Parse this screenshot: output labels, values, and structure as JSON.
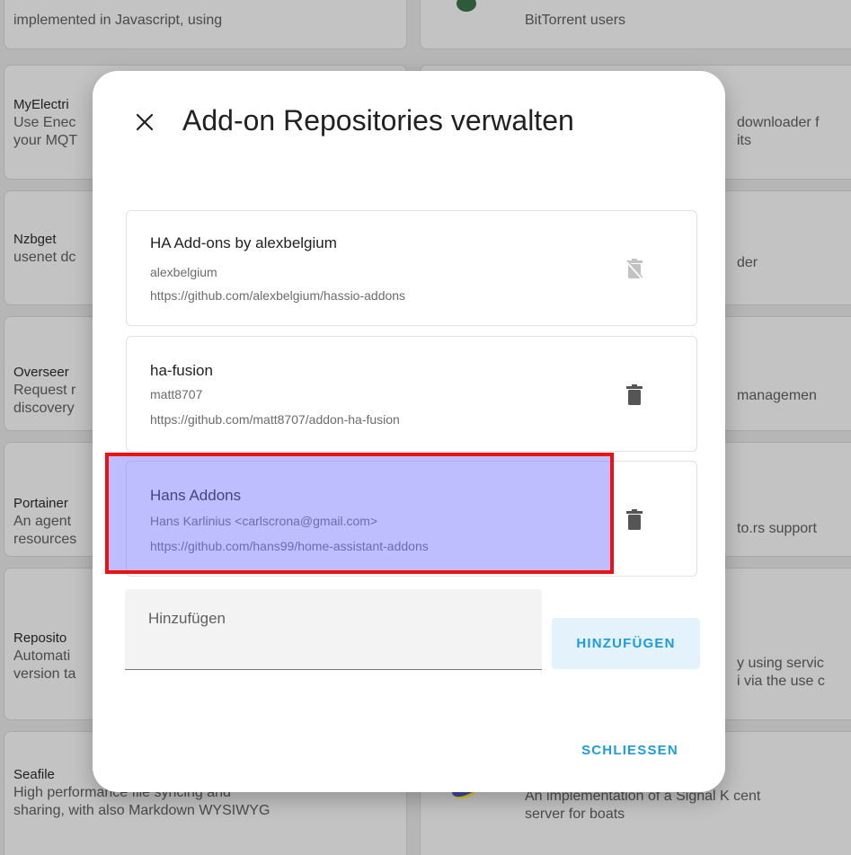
{
  "background": {
    "left_cards": [
      {
        "title": "",
        "desc1": "implemented in Javascript, using",
        "desc2": ""
      },
      {
        "title": "MyElectri",
        "desc1": "Use Enec",
        "desc2": "your MQT"
      },
      {
        "title": "Nzbget",
        "desc1": "usenet dc",
        "desc2": ""
      },
      {
        "title": "Overseer",
        "desc1": "Request r",
        "desc2": "discovery"
      },
      {
        "title": "Portainer",
        "desc1": "An agent",
        "desc2": "resources"
      },
      {
        "title": "Reposito",
        "desc1": "Automati",
        "desc2": "version ta"
      },
      {
        "title": "Seafile",
        "desc1": "High performance file syncing and",
        "desc2": "sharing, with also Markdown WYSIWYG"
      }
    ],
    "right_cards": [
      {
        "desc1": "BitTorrent users",
        "desc2": ""
      },
      {
        "desc1": "downloader f",
        "desc2": "its"
      },
      {
        "desc1": "der",
        "desc2": ""
      },
      {
        "desc1": "managemen",
        "desc2": ""
      },
      {
        "desc1": "to.rs support",
        "desc2": ""
      },
      {
        "desc1": "y using servic",
        "desc2": "i via the use c"
      },
      {
        "desc1": "An implementation of a Signal K cent",
        "desc2": "server for boats"
      }
    ]
  },
  "dialog": {
    "title": "Add-on Repositories verwalten",
    "close_icon": "close-icon",
    "repositories": [
      {
        "name": "HA Add-ons by alexbelgium",
        "maintainer": "alexbelgium",
        "url": "https://github.com/alexbelgium/hassio-addons",
        "action_icon": "delete-off-icon",
        "removable": false
      },
      {
        "name": "ha-fusion",
        "maintainer": "matt8707",
        "url": "https://github.com/matt8707/addon-ha-fusion",
        "action_icon": "delete-icon",
        "removable": true
      },
      {
        "name": "Hans Addons",
        "maintainer": "Hans Karlinius <carlscrona@gmail.com>",
        "url": "https://github.com/hans99/home-assistant-addons",
        "action_icon": "delete-icon",
        "removable": true
      }
    ],
    "add_field": {
      "placeholder": "Hinzufügen",
      "value": ""
    },
    "add_button_label": "HINZUFÜGEN",
    "close_button_label": "SCHLIESSEN"
  },
  "colors": {
    "accent": "#1e9bd9",
    "highlight_fill": "#6e6eff",
    "highlight_border": "#ee1111"
  }
}
